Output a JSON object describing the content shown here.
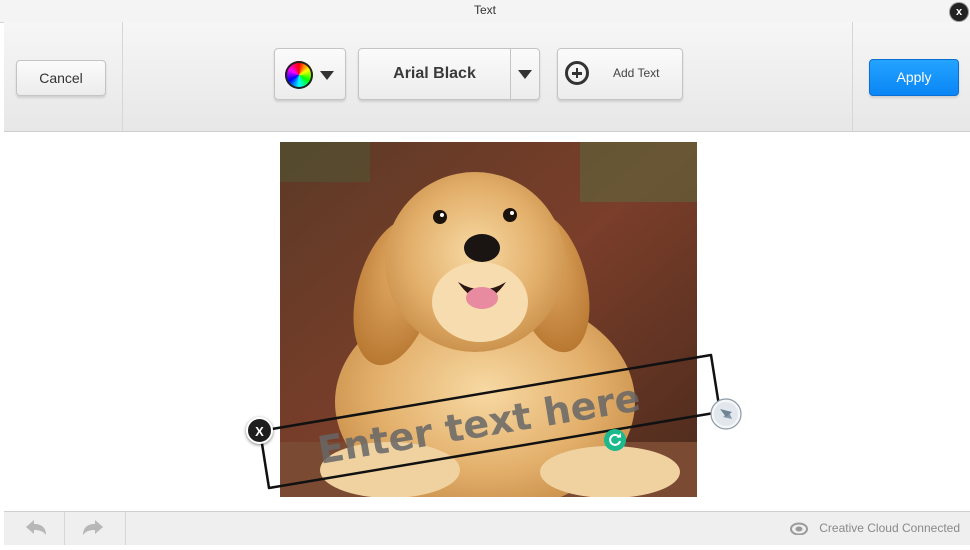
{
  "window": {
    "title": "Text",
    "close_label": "x"
  },
  "toolbar": {
    "cancel_label": "Cancel",
    "font_name": "Arial Black",
    "add_text_label": "Add Text",
    "apply_label": "Apply",
    "apply_color": "#0a86f5"
  },
  "canvas": {
    "text_placeholder": "Enter text here",
    "delete_label": "X"
  },
  "statusbar": {
    "cc_status": "Creative Cloud Connected"
  }
}
